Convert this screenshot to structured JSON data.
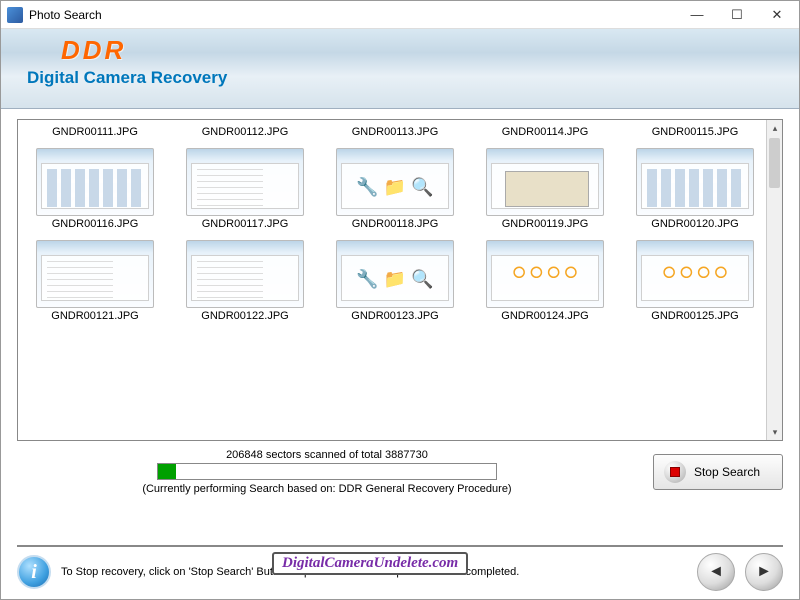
{
  "window": {
    "title": "Photo Search"
  },
  "header": {
    "logo": "DDR",
    "subtitle": "Digital Camera Recovery"
  },
  "files": [
    {
      "name": "GNDR00111.JPG",
      "thumbClass": ""
    },
    {
      "name": "GNDR00112.JPG",
      "thumbClass": ""
    },
    {
      "name": "GNDR00113.JPG",
      "thumbClass": ""
    },
    {
      "name": "GNDR00114.JPG",
      "thumbClass": ""
    },
    {
      "name": "GNDR00115.JPG",
      "thumbClass": ""
    },
    {
      "name": "GNDR00116.JPG",
      "thumbClass": "thumbs"
    },
    {
      "name": "GNDR00117.JPG",
      "thumbClass": "list"
    },
    {
      "name": "GNDR00118.JPG",
      "thumbClass": "icons"
    },
    {
      "name": "GNDR00119.JPG",
      "thumbClass": "dialog"
    },
    {
      "name": "GNDR00120.JPG",
      "thumbClass": "thumbs"
    },
    {
      "name": "GNDR00121.JPG",
      "thumbClass": "list"
    },
    {
      "name": "GNDR00122.JPG",
      "thumbClass": "list"
    },
    {
      "name": "GNDR00123.JPG",
      "thumbClass": "icons"
    },
    {
      "name": "GNDR00124.JPG",
      "thumbClass": "circles"
    },
    {
      "name": "GNDR00125.JPG",
      "thumbClass": "circles"
    }
  ],
  "progress": {
    "text": "206848 sectors scanned of total 3887730",
    "caption": "(Currently performing Search based on:  DDR General Recovery Procedure)",
    "percent": 5.3
  },
  "stop": {
    "label": "Stop Search"
  },
  "footer": {
    "tip": "To Stop recovery, click on 'Stop Search' Button or please wait for the process to be completed."
  },
  "watermark": "DigitalCameraUndelete.com"
}
